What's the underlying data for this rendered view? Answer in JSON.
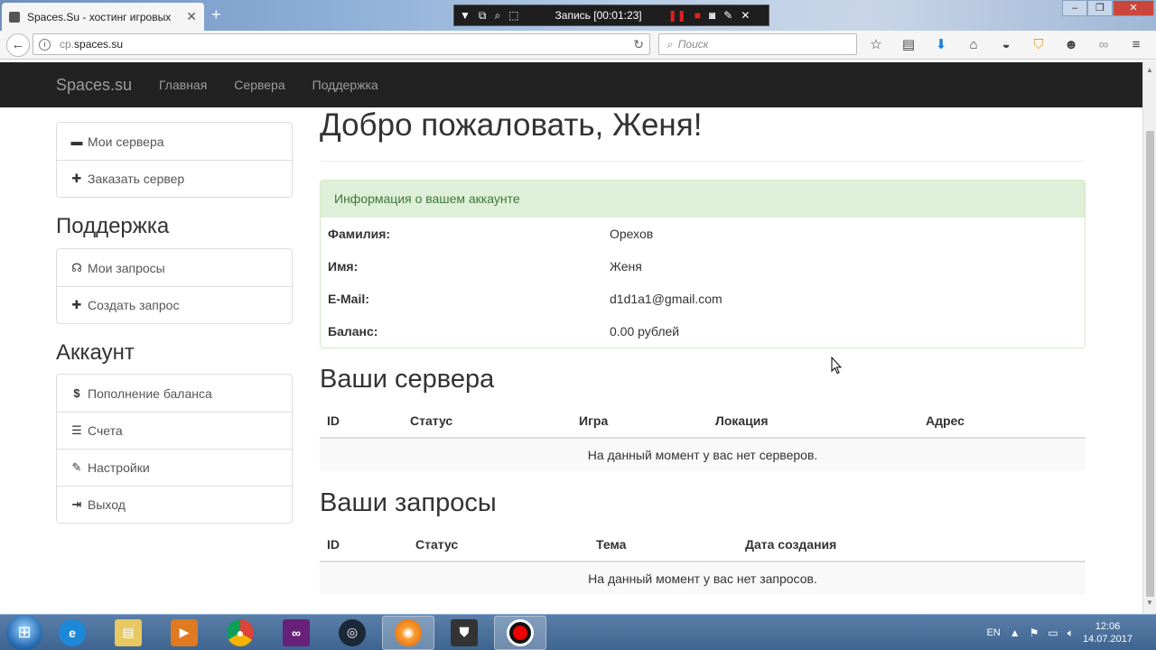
{
  "browser": {
    "tab_title": "Spaces.Su - хостинг игровых",
    "url_prefix": "cp.",
    "url_domain": "spaces.su",
    "search_placeholder": "Поиск",
    "recording_label": "Запись [00:01:23]"
  },
  "site": {
    "brand": "Spaces.su",
    "nav": [
      "Главная",
      "Сервера",
      "Поддержка"
    ]
  },
  "sidebar": {
    "servers_items": [
      {
        "label": "Мои сервера",
        "icon": "server-icon"
      },
      {
        "label": "Заказать сервер",
        "icon": "plus-icon"
      }
    ],
    "support_heading": "Поддержка",
    "support_items": [
      {
        "label": "Мои запросы",
        "icon": "headphones-icon"
      },
      {
        "label": "Создать запрос",
        "icon": "plus-icon"
      }
    ],
    "account_heading": "Аккаунт",
    "account_items": [
      {
        "label": "Пополнение баланса",
        "icon": "dollar-icon"
      },
      {
        "label": "Счета",
        "icon": "list-icon"
      },
      {
        "label": "Настройки",
        "icon": "wrench-icon"
      },
      {
        "label": "Выход",
        "icon": "logout-icon"
      }
    ]
  },
  "main": {
    "welcome": "Добро пожаловать, Женя!",
    "account_panel": {
      "title": "Информация о вашем аккаунте",
      "rows": [
        {
          "key": "Фамилия:",
          "value": "Орехов"
        },
        {
          "key": "Имя:",
          "value": "Женя"
        },
        {
          "key": "E-Mail:",
          "value": "d1d1a1@gmail.com"
        },
        {
          "key": "Баланс:",
          "value": "0.00 рублей"
        }
      ]
    },
    "servers": {
      "heading": "Ваши сервера",
      "columns": [
        "ID",
        "Статус",
        "Игра",
        "Локация",
        "Адрес"
      ],
      "empty": "На данный момент у вас нет серверов."
    },
    "requests": {
      "heading": "Ваши запросы",
      "columns": [
        "ID",
        "Статус",
        "Тема",
        "Дата создания"
      ],
      "empty": "На данный момент у вас нет запросов."
    }
  },
  "taskbar": {
    "lang": "EN",
    "time": "12:06",
    "date": "14.07.2017"
  },
  "colors": {
    "navbar_bg": "#222222",
    "panel_header_bg": "#dff0d8",
    "panel_header_text": "#3c763d"
  }
}
